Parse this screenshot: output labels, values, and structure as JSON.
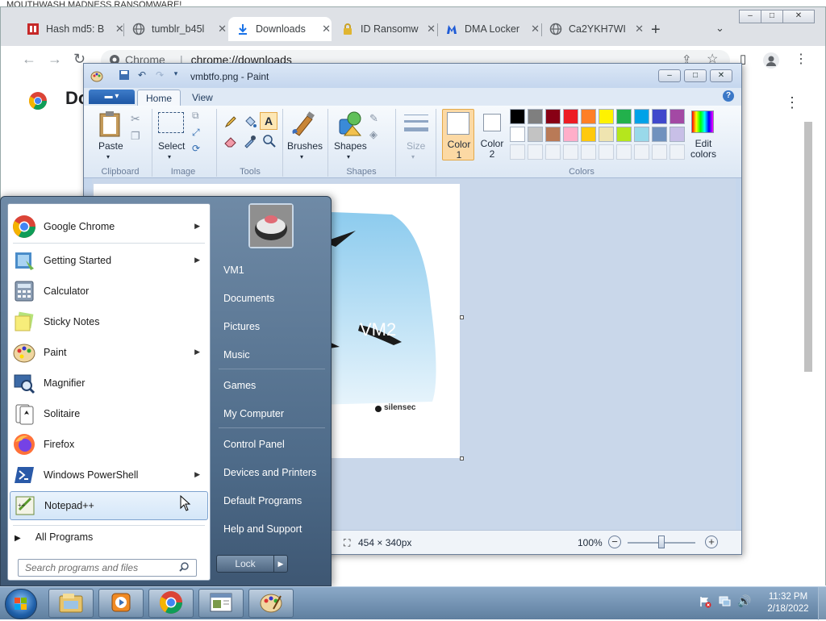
{
  "banner": {
    "text": "MOUTHWASH MADNESS RANSOMWARE!"
  },
  "chrome": {
    "tabs": [
      {
        "title": "Hash md5: B",
        "icon": "ransomware-flag-icon",
        "active": false
      },
      {
        "title": "tumblr_b45l",
        "icon": "globe-icon",
        "active": false
      },
      {
        "title": "Downloads",
        "icon": "download-icon",
        "active": true
      },
      {
        "title": "ID Ransomw",
        "icon": "lock-icon",
        "active": false
      },
      {
        "title": "DMA Locker",
        "icon": "malwarebytes-icon",
        "active": false
      },
      {
        "title": "Ca2YKH7WI",
        "icon": "globe-icon",
        "active": false
      }
    ],
    "new_tab_symbol": "+",
    "tab_menu_symbol": "⌄",
    "address": {
      "chip": "Chrome",
      "separator": "|",
      "url": "chrome://downloads"
    },
    "page_heading": "Do",
    "window_controls": [
      "–",
      "□",
      "✕"
    ]
  },
  "paint": {
    "title": "vmbtfo.png - Paint",
    "file_tab": "▬ ▾",
    "tabs": [
      "Home",
      "View"
    ],
    "groups": {
      "clipboard": {
        "label": "Clipboard",
        "paste": "Paste"
      },
      "image": {
        "label": "Image",
        "select": "Select"
      },
      "tools": {
        "label": "Tools"
      },
      "brushes": {
        "label": "Brushes"
      },
      "shapes": {
        "label": "Shapes",
        "button": "Shapes"
      },
      "size": {
        "label": "Size"
      },
      "colors": {
        "label": "Colors",
        "color1": "Color\n1",
        "color2": "Color\n2",
        "edit": "Edit\ncolors"
      }
    },
    "color1_line1": "Color",
    "color1_line2": "1",
    "color2_line1": "Color",
    "color2_line2": "2",
    "edit_line1": "Edit",
    "edit_line2": "colors",
    "palette_row1": [
      "#000000",
      "#7f7f7f",
      "#880015",
      "#ed1c24",
      "#ff7f27",
      "#fff200",
      "#22b14c",
      "#00a2e8",
      "#3f48cc",
      "#a349a4"
    ],
    "palette_row2": [
      "#ffffff",
      "#c3c3c3",
      "#b97a57",
      "#ffaec9",
      "#ffc90e",
      "#efe4b0",
      "#b5e61d",
      "#99d9ea",
      "#7092be",
      "#c8bfe7"
    ],
    "canvas_text": "VM2",
    "canvas_brand": "silensec",
    "status": {
      "size": "454 × 340px",
      "zoom": "100%"
    }
  },
  "start_menu": {
    "programs": [
      {
        "label": "Google Chrome",
        "icon": "chrome-icon",
        "arrow": true
      },
      {
        "label": "Getting Started",
        "icon": "getting-started-icon",
        "arrow": true
      },
      {
        "label": "Calculator",
        "icon": "calculator-icon",
        "arrow": false
      },
      {
        "label": "Sticky Notes",
        "icon": "sticky-notes-icon",
        "arrow": false
      },
      {
        "label": "Paint",
        "icon": "paint-icon",
        "arrow": true
      },
      {
        "label": "Magnifier",
        "icon": "magnifier-icon",
        "arrow": false
      },
      {
        "label": "Solitaire",
        "icon": "solitaire-icon",
        "arrow": false
      },
      {
        "label": "Firefox",
        "icon": "firefox-icon",
        "arrow": false
      },
      {
        "label": "Windows PowerShell",
        "icon": "powershell-icon",
        "arrow": true
      },
      {
        "label": "Notepad++",
        "icon": "notepadpp-icon",
        "arrow": false
      }
    ],
    "all_programs": "All Programs",
    "search_placeholder": "Search programs and files",
    "right_items": [
      "VM1",
      "Documents",
      "Pictures",
      "Music",
      "Games",
      "My Computer",
      "Control Panel",
      "Devices and Printers",
      "Default Programs",
      "Help and Support"
    ],
    "lock_label": "Lock"
  },
  "taskbar": {
    "buttons": [
      "explorer-icon",
      "media-player-icon",
      "chrome-icon",
      "notepad-window-icon",
      "paint-icon"
    ],
    "clock_time": "11:32 PM",
    "clock_date": "2/18/2022"
  }
}
